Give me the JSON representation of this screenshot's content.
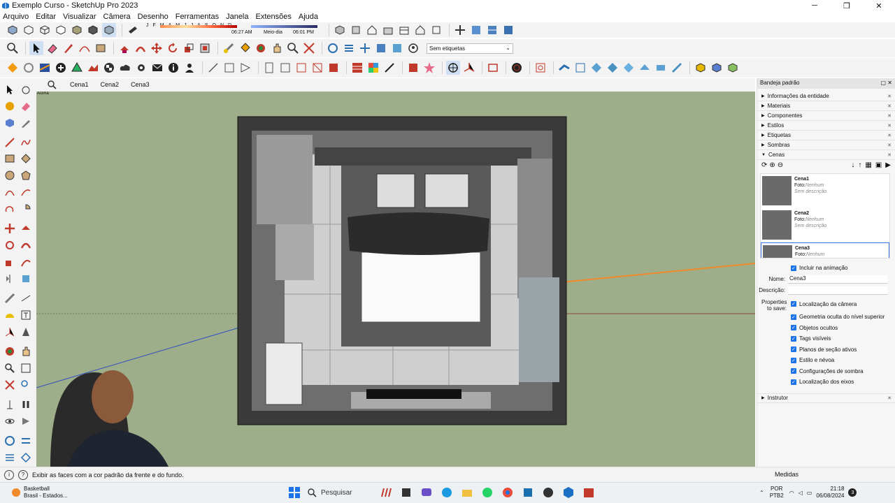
{
  "window": {
    "title": "Exemplo Curso - SketchUp Pro 2023",
    "minimize": "─",
    "maximize": "❐",
    "close": "✕"
  },
  "menu": [
    "Arquivo",
    "Editar",
    "Visualizar",
    "Câmera",
    "Desenho",
    "Ferramentas",
    "Janela",
    "Extensões",
    "Ajuda"
  ],
  "shadow_settings": {
    "months": [
      "J",
      "F",
      "M",
      "A",
      "M",
      "J",
      "J",
      "A",
      "S",
      "O",
      "N",
      "D"
    ],
    "start_time": "06:27 AM",
    "mid_label": "Meio-dia",
    "end_time": "06:01 PM"
  },
  "tag_filter": "Sem etiquetas",
  "scene_tabs": [
    "Cena1",
    "Cena2",
    "Cena3"
  ],
  "view_label": "Acima",
  "panel": {
    "title": "Bandeja padrão",
    "sections": [
      "Informações da entidade",
      "Materiais",
      "Componentes",
      "Estilos",
      "Etiquetas",
      "Sombras",
      "Cenas"
    ],
    "scenes": [
      {
        "name": "Cena1",
        "foto_label": "Foto:",
        "foto_value": "Nenhum",
        "desc": "Sem descrição"
      },
      {
        "name": "Cena2",
        "foto_label": "Foto:",
        "foto_value": "Nenhum",
        "desc": "Sem descrição"
      },
      {
        "name": "Cena3",
        "foto_label": "Foto:",
        "foto_value": "Nenhum",
        "desc": ""
      }
    ],
    "include_animation": "Incluir na animação",
    "name_label": "Nome:",
    "name_value": "Cena3",
    "desc_label": "Descrição:",
    "properties_label": "Properties to save:",
    "properties": [
      "Localização da câmera",
      "Geometria oculta do nível superior",
      "Objetos ocultos",
      "Tags visíveis",
      "Planos de seção ativos",
      "Estilo e névoa",
      "Configurações de sombra",
      "Localização dos eixos"
    ],
    "instructor": "Instrutor"
  },
  "status": {
    "message": "Exibir as faces com a cor padrão da frente e do fundo.",
    "measures_label": "Medidas"
  },
  "taskbar": {
    "weather_title": "Basketball",
    "weather_sub": "Brasil - Estados...",
    "search_placeholder": "Pesquisar",
    "lang1": "POR",
    "lang2": "PTB2",
    "time": "21:18",
    "date": "06/08/2024",
    "notifications": "3"
  },
  "colors": {
    "viewport_bg": "#9fae8a",
    "accent_blue": "#1a73e8",
    "axis_orange": "#f08a2a",
    "axis_red": "#c0392b",
    "axis_blue": "#2f4fbf"
  }
}
